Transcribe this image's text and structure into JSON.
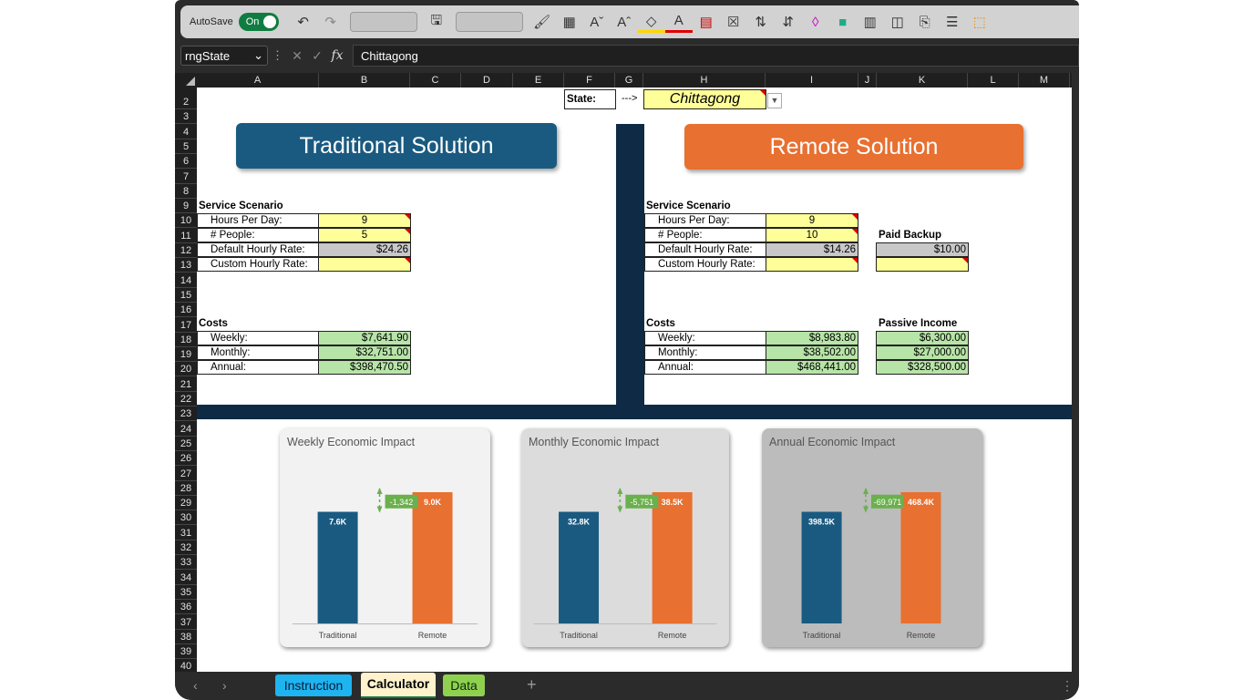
{
  "toolbar": {
    "autosave_label": "AutoSave",
    "toggle_label": "On",
    "icons": [
      "undo-icon",
      "redo-icon",
      "save-icon",
      "paintbrush-icon",
      "borders-icon",
      "increase-font-icon",
      "decrease-font-icon",
      "fill-color-icon",
      "font-color-icon",
      "table-icon",
      "conditional-format-icon",
      "sort-ascending-icon",
      "sort-descending-icon",
      "eraser-icon",
      "format-cells-icon",
      "format-table-icon",
      "freeze-panes-icon",
      "paste-icon",
      "align-icon",
      "drawing-icon"
    ]
  },
  "formula_bar": {
    "name_box": "rngState",
    "formula": "Chittagong"
  },
  "columns": [
    "A",
    "B",
    "C",
    "D",
    "E",
    "F",
    "G",
    "H",
    "I",
    "J",
    "K",
    "L",
    "M"
  ],
  "rows": [
    "2",
    "3",
    "4",
    "5",
    "6",
    "7",
    "8",
    "9",
    "10",
    "11",
    "12",
    "13",
    "14",
    "15",
    "16",
    "17",
    "18",
    "19",
    "20",
    "21",
    "22",
    "23",
    "24",
    "25",
    "26",
    "27",
    "28",
    "29",
    "30",
    "31",
    "32",
    "33",
    "34",
    "35",
    "36",
    "37",
    "38",
    "39",
    "40"
  ],
  "state": {
    "label": "State:",
    "arrow": "--->",
    "value": "Chittagong"
  },
  "traditional": {
    "title": "Traditional Solution",
    "scenario_header": "Service Scenario",
    "inputs": [
      {
        "label": "Hours Per Day:",
        "value": "9"
      },
      {
        "label": "# People:",
        "value": "5"
      },
      {
        "label": "Default Hourly Rate:",
        "value": "$24.26"
      },
      {
        "label": "Custom Hourly Rate:",
        "value": ""
      }
    ],
    "costs_header": "Costs",
    "costs": [
      {
        "label": "Weekly:",
        "value": "$7,641.90"
      },
      {
        "label": "Monthly:",
        "value": "$32,751.00"
      },
      {
        "label": "Annual:",
        "value": "$398,470.50"
      }
    ]
  },
  "remote": {
    "title": "Remote Solution",
    "scenario_header": "Service Scenario",
    "inputs": [
      {
        "label": "Hours Per Day:",
        "value": "9"
      },
      {
        "label": "# People:",
        "value": "10"
      },
      {
        "label": "Default Hourly Rate:",
        "value": "$14.26"
      },
      {
        "label": "Custom Hourly Rate:",
        "value": ""
      }
    ],
    "paid_backup_header": "Paid Backup",
    "paid_backup": [
      "$10.00",
      ""
    ],
    "costs_header": "Costs",
    "costs": [
      {
        "label": "Weekly:",
        "value": "$8,983.80"
      },
      {
        "label": "Monthly:",
        "value": "$38,502.00"
      },
      {
        "label": "Annual:",
        "value": "$468,441.00"
      }
    ],
    "passive_header": "Passive Income",
    "passive": [
      "$6,300.00",
      "$27,000.00",
      "$328,500.00"
    ]
  },
  "colors": {
    "traditional": "#1a5a80",
    "remote": "#e87030",
    "divider": "#0e2a44",
    "delta": "#6ab04c",
    "input_yellow": "#ffff99",
    "output_green": "#b7e4a7"
  },
  "chart_data": [
    {
      "type": "bar",
      "title": "Weekly Economic Impact",
      "categories": [
        "Traditional",
        "Remote"
      ],
      "values": [
        7641.9,
        8983.8
      ],
      "value_labels": [
        "7.6K",
        "9.0K"
      ],
      "delta_label": "-1,342",
      "background": "#f2f2f2"
    },
    {
      "type": "bar",
      "title": "Monthly Economic Impact",
      "categories": [
        "Traditional",
        "Remote"
      ],
      "values": [
        32751,
        38502
      ],
      "value_labels": [
        "32.8K",
        "38.5K"
      ],
      "delta_label": "-5,751",
      "background": "#dcdcdc"
    },
    {
      "type": "bar",
      "title": "Annual Economic Impact",
      "categories": [
        "Traditional",
        "Remote"
      ],
      "values": [
        398470.5,
        468441
      ],
      "value_labels": [
        "398.5K",
        "468.4K"
      ],
      "delta_label": "-69,971",
      "background": "#bcbcbc"
    }
  ],
  "tabs": [
    {
      "label": "Instruction",
      "color": "#1eb4f0",
      "active": false
    },
    {
      "label": "Calculator",
      "color": "#fff2cc",
      "active": true
    },
    {
      "label": "Data",
      "color": "#8fd14f",
      "active": false
    }
  ],
  "tabbar": {
    "add_label": "+",
    "more_label": "⋮",
    "prev_label": "‹",
    "next_label": "›"
  }
}
